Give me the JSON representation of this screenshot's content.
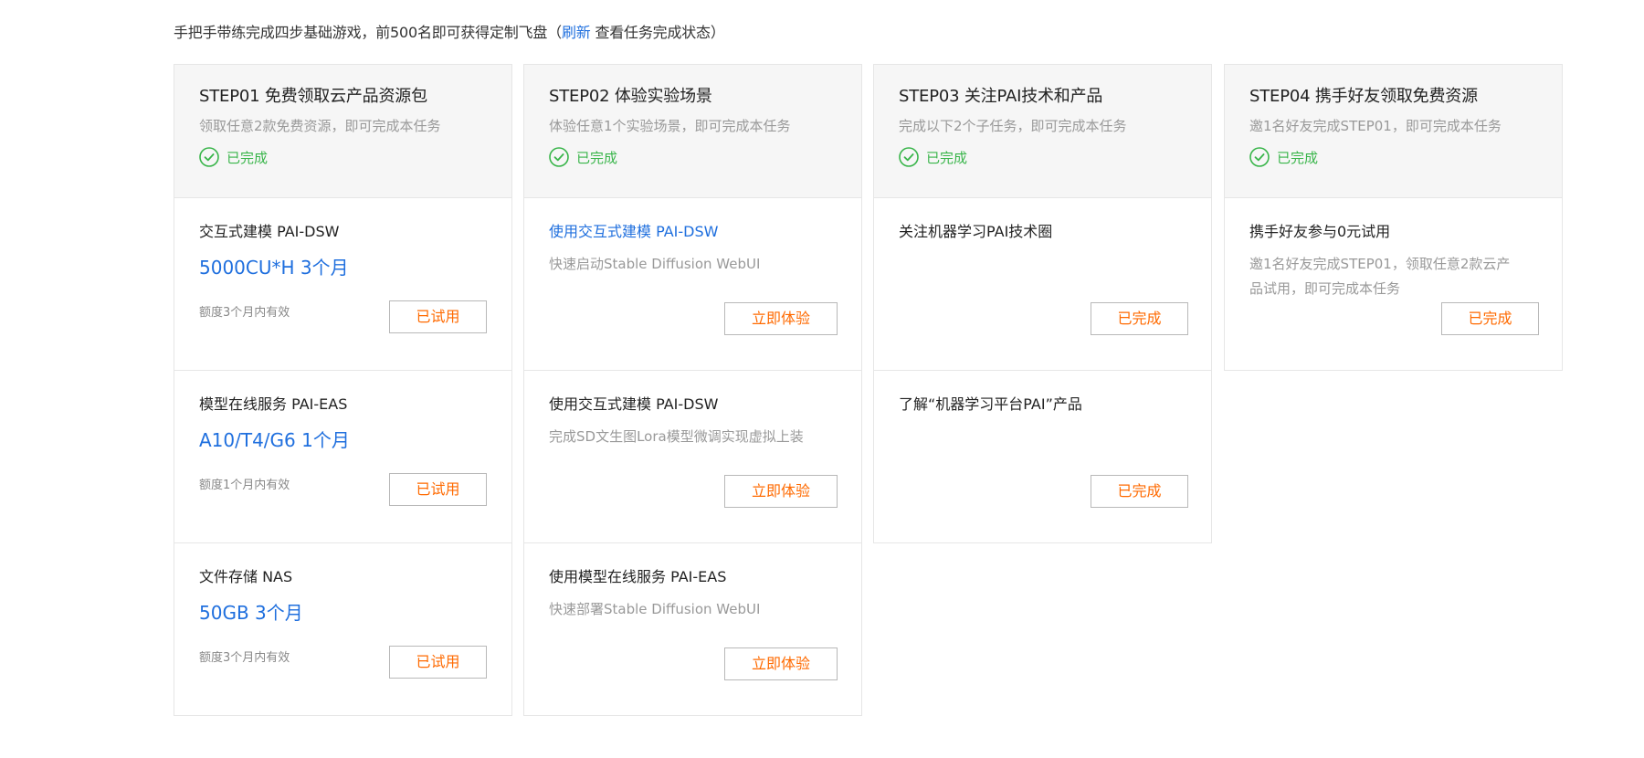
{
  "intro": {
    "text_before": "手把手带练完成四步基础游戏，前500名即可获得定制飞盘（",
    "refresh_link": "刷新",
    "text_after": "查看任务完成状态）"
  },
  "steps": [
    {
      "title": "STEP01 免费领取云产品资源包",
      "desc": "领取任意2款免费资源，即可完成本任务",
      "status": "已完成",
      "items": [
        {
          "name": "交互式建模 PAI-DSW",
          "offer": "5000CU*H 3个月",
          "validity": "额度3个月内有效",
          "button": "已试用"
        },
        {
          "name": "模型在线服务 PAI-EAS",
          "offer": "A10/T4/G6 1个月",
          "validity": "额度1个月内有效",
          "button": "已试用"
        },
        {
          "name": "文件存储 NAS",
          "offer": "50GB 3个月",
          "validity": "额度3个月内有效",
          "button": "已试用"
        }
      ]
    },
    {
      "title": "STEP02 体验实验场景",
      "desc": "体验任意1个实验场景，即可完成本任务",
      "status": "已完成",
      "items": [
        {
          "name": "使用交互式建模 PAI-DSW",
          "sub": "快速启动Stable Diffusion WebUI",
          "button": "立即体验"
        },
        {
          "name": "使用交互式建模 PAI-DSW",
          "sub": "完成SD文生图Lora模型微调实现虚拟上装",
          "button": "立即体验"
        },
        {
          "name": "使用模型在线服务 PAI-EAS",
          "sub": "快速部署Stable Diffusion WebUI",
          "button": "立即体验"
        }
      ]
    },
    {
      "title": "STEP03 关注PAI技术和产品",
      "desc": "完成以下2个子任务，即可完成本任务",
      "status": "已完成",
      "items": [
        {
          "name": "关注机器学习PAI技术圈",
          "button": "已完成"
        },
        {
          "name": "了解“机器学习平台PAI”产品",
          "button": "已完成"
        }
      ]
    },
    {
      "title": "STEP04 携手好友领取免费资源",
      "desc": "邀1名好友完成STEP01，即可完成本任务",
      "status": "已完成",
      "items": [
        {
          "name": "携手好友参与0元试用",
          "sub_line1": "邀1名好友完成STEP01，领取任意2款云产",
          "sub_line2": "品试用，即可完成本任务",
          "button": "已完成"
        }
      ]
    }
  ],
  "colors": {
    "accent": "#1f6fde",
    "success": "#39b54a",
    "button_text": "#ff6a00"
  },
  "icons": {
    "status": "check-circle-icon"
  }
}
